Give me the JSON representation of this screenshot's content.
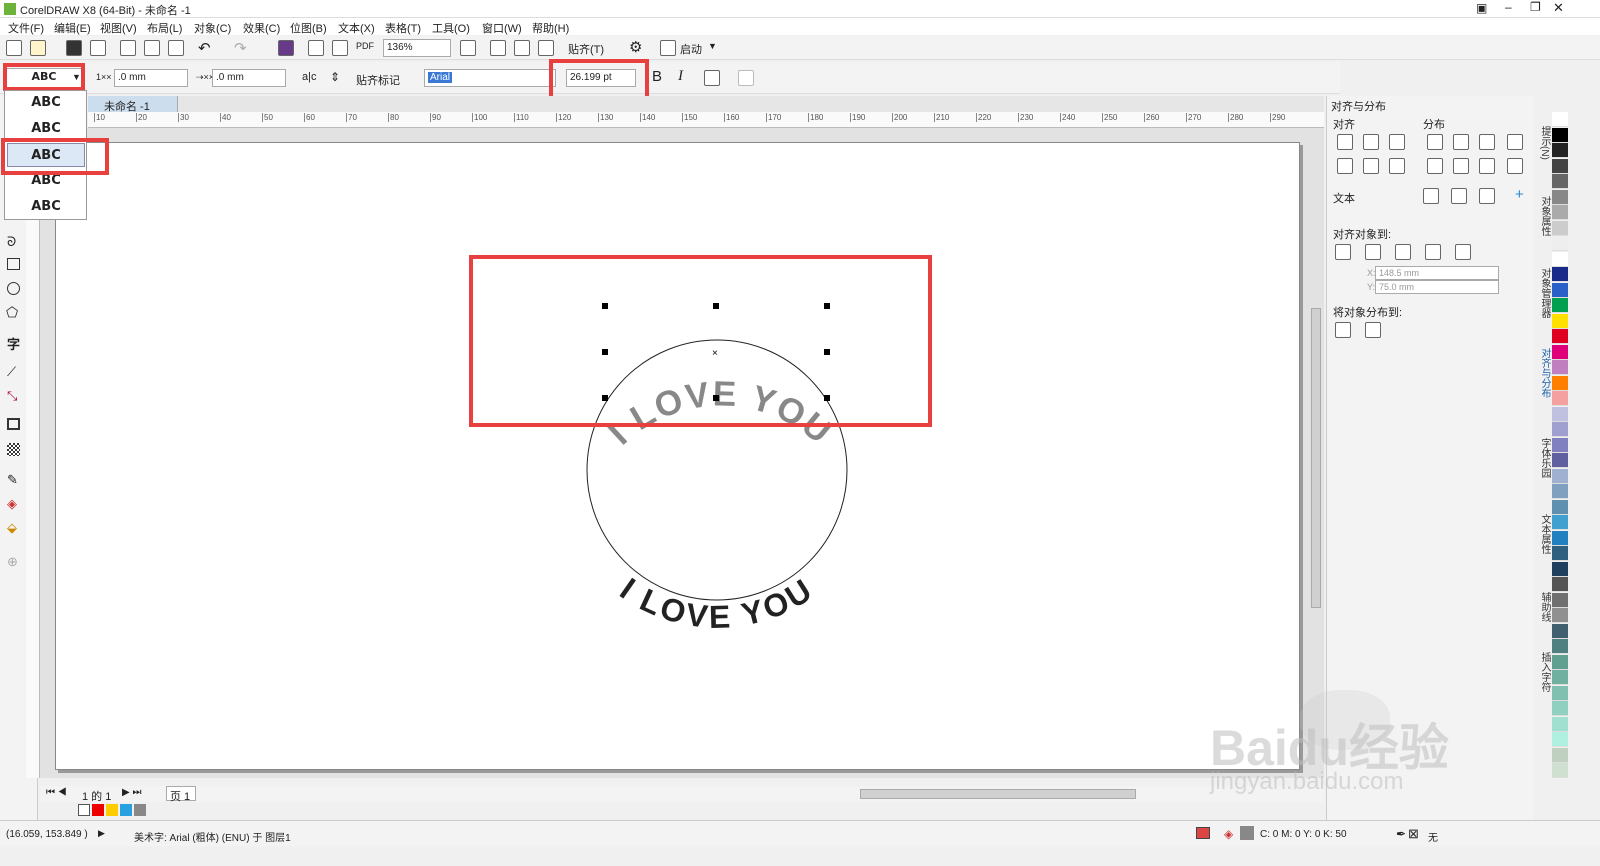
{
  "title": "CorelDRAW X8 (64-Bit) - 未命名 -1",
  "menus": [
    "文件(F)",
    "编辑(E)",
    "视图(V)",
    "布局(L)",
    "对象(C)",
    "效果(C)",
    "位图(B)",
    "文本(X)",
    "表格(T)",
    "工具(O)",
    "窗口(W)",
    "帮助(H)"
  ],
  "toolbar": {
    "zoom": "136%",
    "snap": "贴齐(T)",
    "launch": "启动"
  },
  "propbar": {
    "offset_h": ".0 mm",
    "offset_v": ".0 mm",
    "snap_marks": "贴齐标记",
    "font": "Arial",
    "size": "26.199 pt",
    "bold": "B",
    "italic": "I"
  },
  "doc_tab": "未命名 -1",
  "ruler_ticks": [
    "10",
    "20",
    "30",
    "40",
    "50",
    "60",
    "70",
    "80",
    "90",
    "100",
    "110",
    "120",
    "130",
    "140",
    "150",
    "160",
    "170",
    "180",
    "190",
    "200",
    "210",
    "220",
    "230",
    "240",
    "250",
    "260",
    "270",
    "280",
    "290"
  ],
  "dropdown": {
    "selected": "ABC",
    "items": [
      "ABC",
      "ABC",
      "ABC",
      "ABC",
      "ABC"
    ]
  },
  "canvas": {
    "top_text": "I LOVE YOU",
    "bottom_text": "I LOVE YOU"
  },
  "docker": {
    "title": "对齐与分布",
    "align": "对齐",
    "distribute": "分布",
    "text": "文本",
    "align_to": "对齐对象到:",
    "x": "148.5 mm",
    "y": "75.0 mm",
    "distribute_to": "将对象分布到:"
  },
  "docker_tabs": [
    "提示(N)",
    "对象属性",
    "对象管理器",
    "对齐与分布",
    "字体乐园",
    "文本属性",
    "辅助线",
    "插入字符"
  ],
  "page_nav": {
    "pages": "1 的 1",
    "page": "页 1"
  },
  "status": {
    "coords": "(16.059, 153.849 )",
    "info": "美术字: Arial (粗体) (ENU) 于 图层1",
    "color": "C: 0 M: 0 Y: 0 K: 50",
    "none": "无"
  },
  "watermark": {
    "brand": "Baidu经验",
    "url": "jingyan.baidu.com"
  },
  "colors": {
    "red": "#e8403f"
  }
}
